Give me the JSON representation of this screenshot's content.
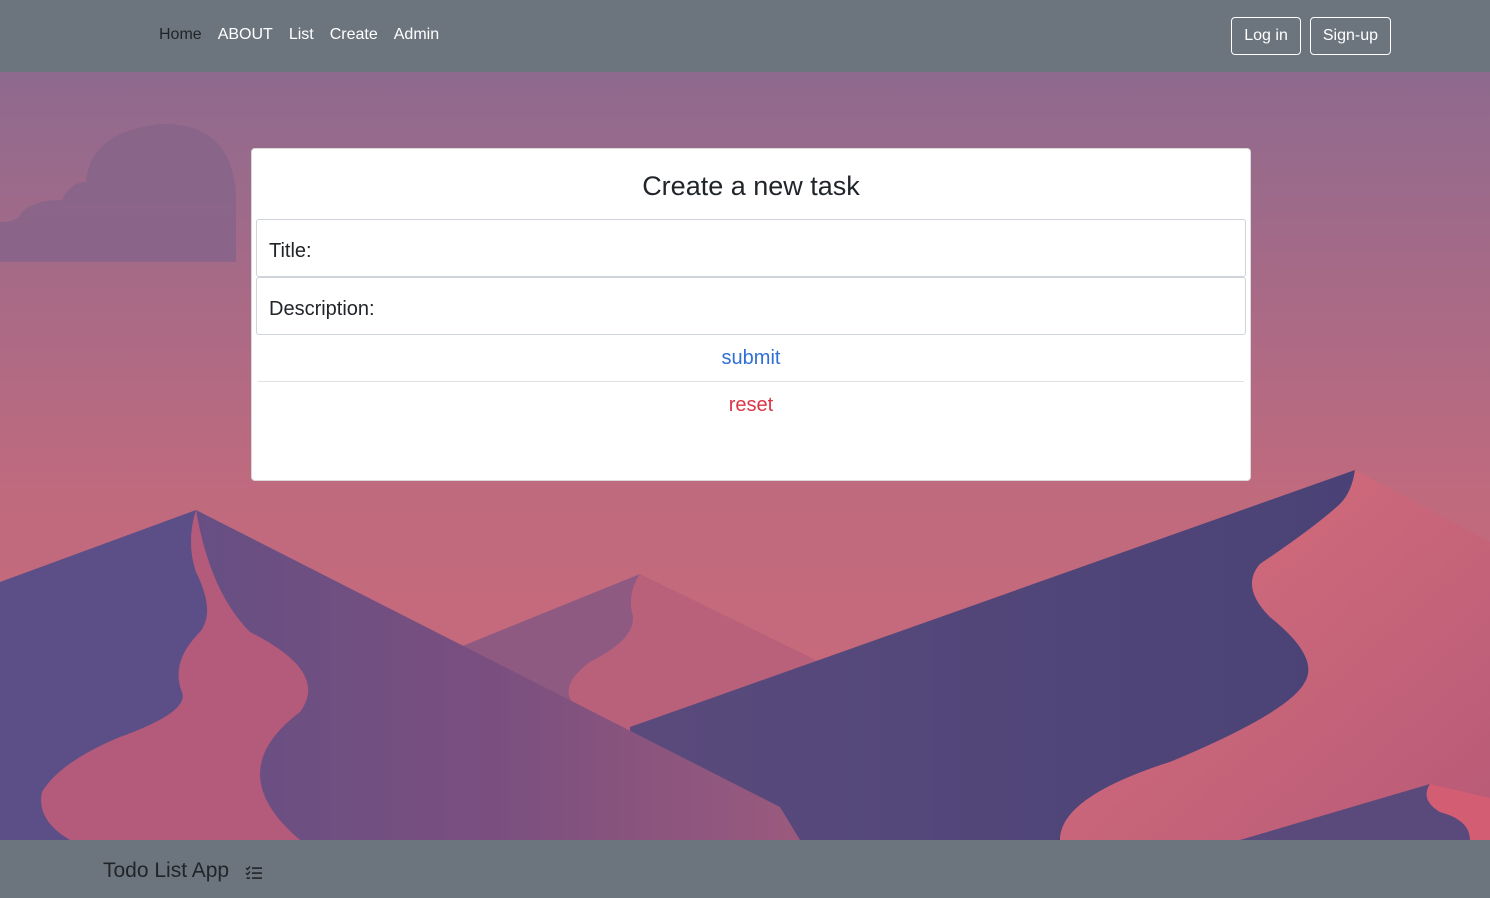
{
  "nav": {
    "links": [
      {
        "label": "Home",
        "active": true
      },
      {
        "label": "ABOUT"
      },
      {
        "label": "List"
      },
      {
        "label": "Create"
      },
      {
        "label": "Admin"
      }
    ],
    "login_label": "Log in",
    "signup_label": "Sign-up"
  },
  "form": {
    "heading": "Create a new task",
    "title_label": "Title:",
    "title_value": "",
    "description_label": "Description:",
    "description_value": "",
    "submit_label": "submit",
    "reset_label": "reset"
  },
  "footer": {
    "brand": "Todo List App",
    "brand_icon": "checklist-icon"
  },
  "colors": {
    "navbar": "#6c757d",
    "submit": "#2f6fd6",
    "reset": "#dc3545",
    "sky_top": "#8e6a8f",
    "sky_bottom": "#c86b7a",
    "dune_dark": "#4e4577"
  }
}
